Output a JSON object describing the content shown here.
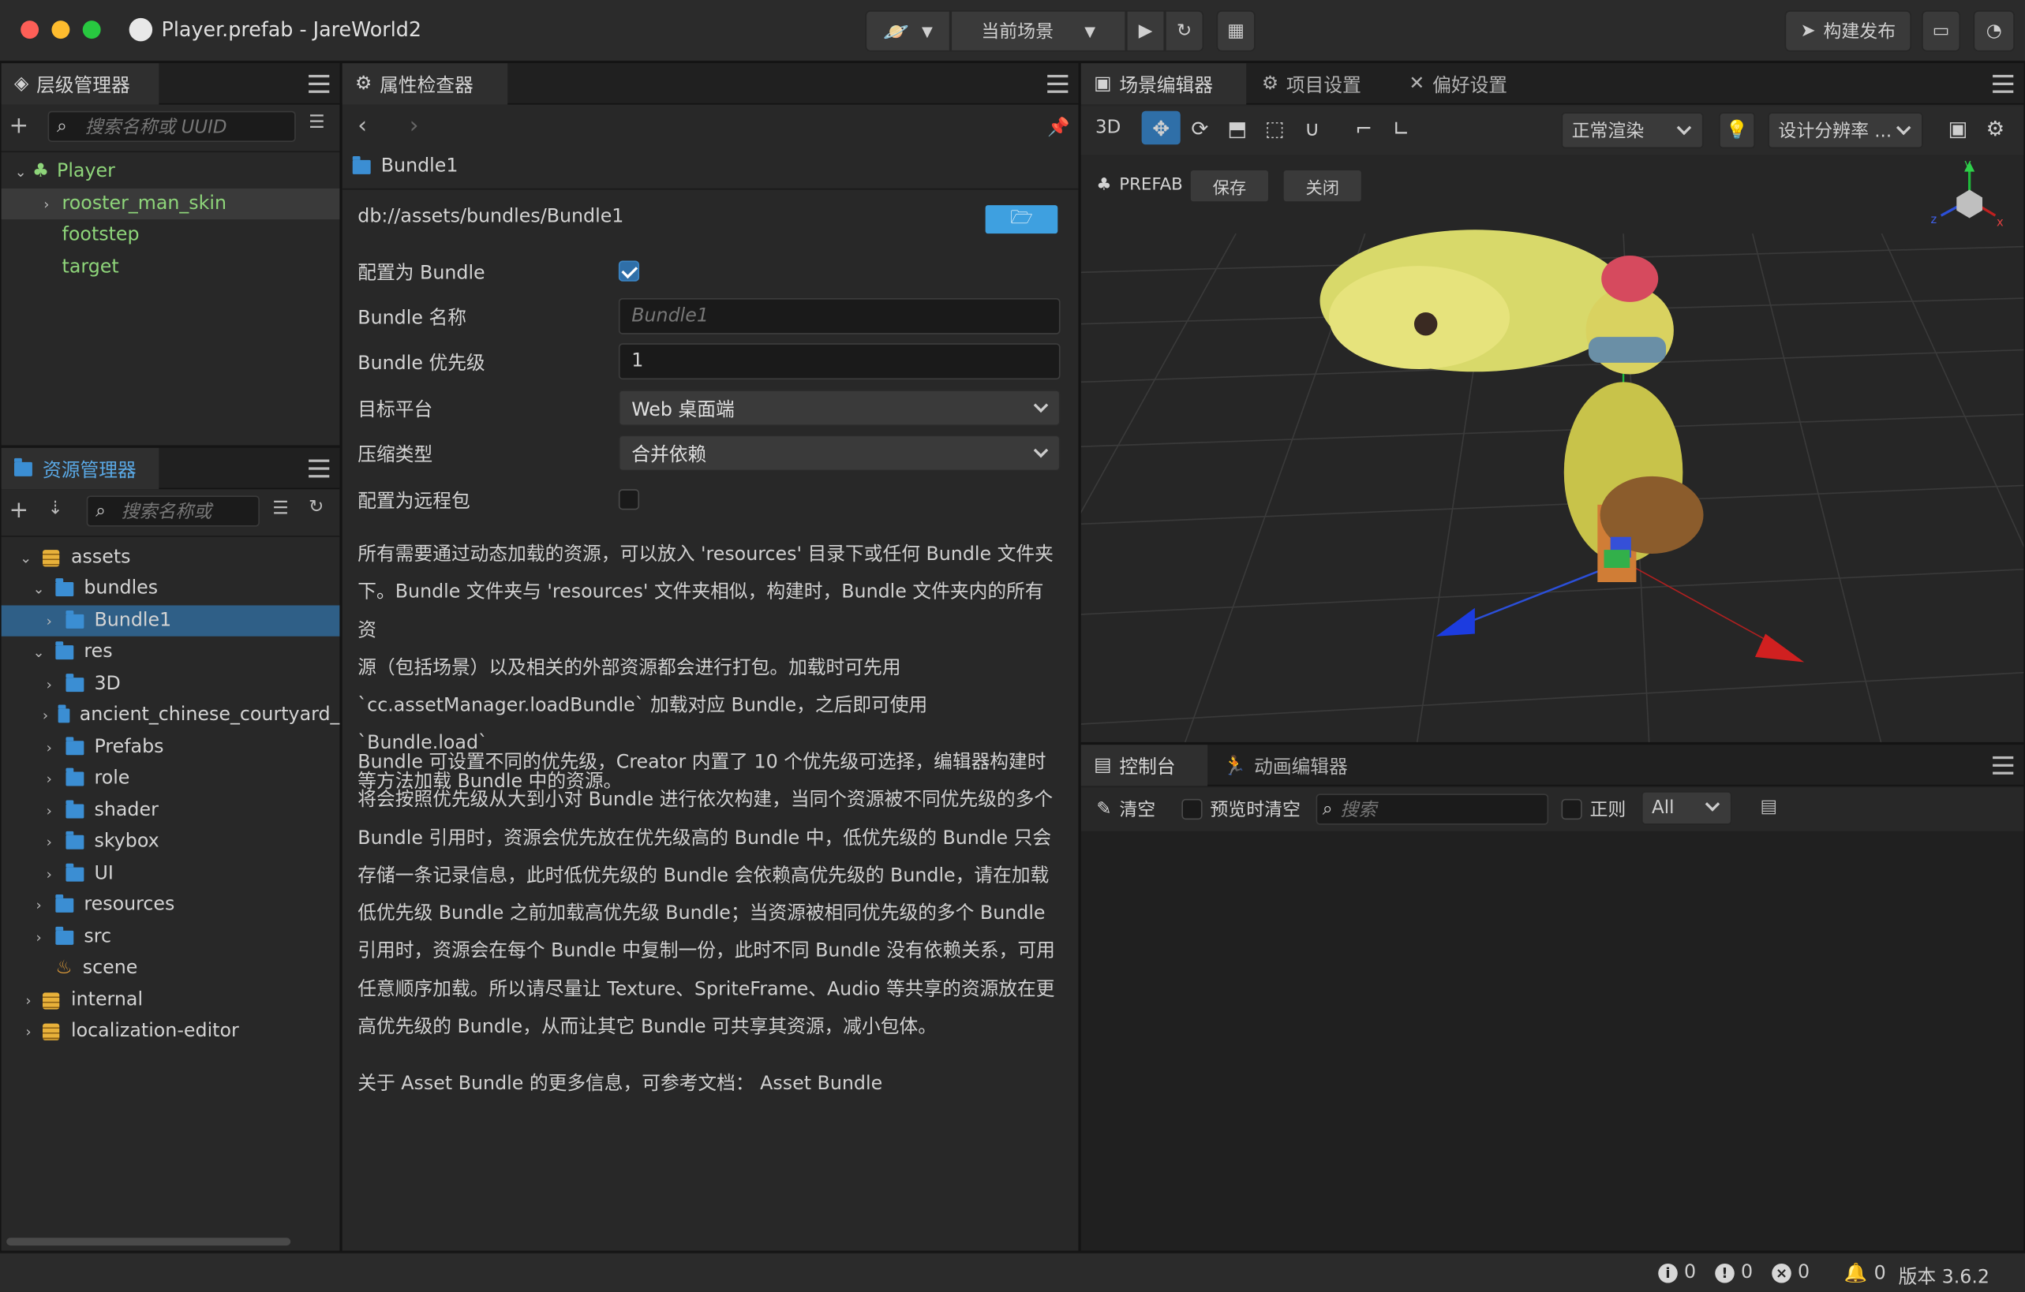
{
  "window": {
    "title": "Player.prefab - JareWorld2"
  },
  "toolbar": {
    "scene_select": "当前场景",
    "publish_label": "构建发布"
  },
  "hierarchy": {
    "title": "层级管理器",
    "search_placeholder": "搜索名称或 UUID",
    "root": "Player",
    "children": [
      "rooster_man_skin",
      "footstep",
      "target"
    ]
  },
  "assets": {
    "title": "资源管理器",
    "search_placeholder": "搜索名称或",
    "tree": [
      "assets",
      "bundles",
      "Bundle1",
      "res",
      "3D",
      "ancient_chinese_courtyard_",
      "Prefabs",
      "role",
      "shader",
      "skybox",
      "UI",
      "resources",
      "src",
      "scene",
      "internal",
      "localization-editor"
    ]
  },
  "inspector": {
    "title": "属性检查器",
    "asset_name": "Bundle1",
    "path": "db://assets/bundles/Bundle1",
    "fields": {
      "is_bundle_label": "配置为 Bundle",
      "name_label": "Bundle 名称",
      "name_placeholder": "Bundle1",
      "priority_label": "Bundle 优先级",
      "priority_value": "1",
      "platform_label": "目标平台",
      "platform_value": "Web 桌面端",
      "compression_label": "压缩类型",
      "compression_value": "合并依赖",
      "remote_label": "配置为远程包"
    },
    "desc1": [
      "所有需要通过动态加载的资源，可以放入 'resources' 目录下或任何 Bundle 文件夹",
      "下。Bundle 文件夹与 'resources' 文件夹相似，构建时，Bundle 文件夹内的所有资",
      "源（包括场景）以及相关的外部资源都会进行打包。加载时可先用",
      "`cc.assetManager.loadBundle` 加载对应 Bundle，之后即可使用 `Bundle.load`",
      "等方法加载 Bundle 中的资源。"
    ],
    "desc2": [
      "Bundle 可设置不同的优先级，Creator 内置了 10 个优先级可选择，编辑器构建时",
      "将会按照优先级从大到小对 Bundle 进行依次构建，当同个资源被不同优先级的多个",
      "Bundle 引用时，资源会优先放在优先级高的 Bundle 中，低优先级的 Bundle 只会",
      "存储一条记录信息，此时低优先级的 Bundle 会依赖高优先级的 Bundle，请在加载",
      "低优先级 Bundle 之前加载高优先级 Bundle；当资源被相同优先级的多个 Bundle",
      "引用时，资源会在每个 Bundle 中复制一份，此时不同 Bundle 没有依赖关系，可用",
      "任意顺序加载。所以请尽量让 Texture、SpriteFrame、Audio 等共享的资源放在更",
      "高优先级的 Bundle，从而让其它 Bundle 可共享其资源，减小包体。"
    ],
    "desc3": "关于 Asset Bundle 的更多信息，可参考文档：  Asset Bundle"
  },
  "scene": {
    "tabs": [
      "场景编辑器",
      "项目设置",
      "偏好设置"
    ],
    "mode_3d": "3D",
    "render_mode": "正常渲染",
    "resolution": "设计分辨率 ...",
    "prefab_label": "PREFAB",
    "save_label": "保存",
    "close_label": "关闭",
    "gizmo_x": "x",
    "gizmo_y": "y",
    "gizmo_z": "z"
  },
  "console": {
    "tabs": [
      "控制台",
      "动画编辑器"
    ],
    "clear_label": "清空",
    "preview_clear_label": "预览时清空",
    "search_placeholder": "搜索",
    "regex_label": "正则",
    "level_value": "All"
  },
  "statusbar": {
    "info": "0",
    "warn": "0",
    "error": "0",
    "notice": "0",
    "version": "版本 3.6.2"
  }
}
